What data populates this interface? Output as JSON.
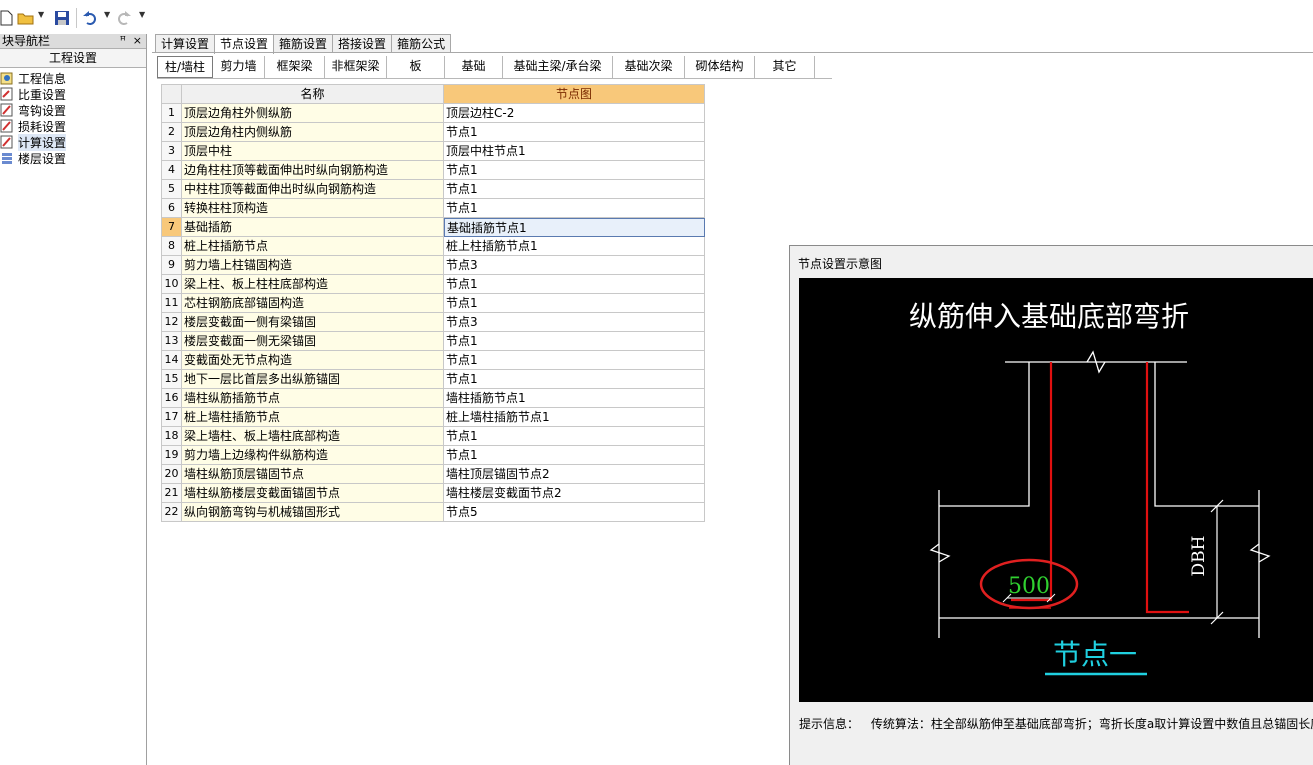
{
  "toolbar": {
    "icons": [
      "new-file-icon",
      "open-folder-icon",
      "save-icon",
      "undo-icon",
      "redo-icon"
    ]
  },
  "nav": {
    "title": "块导航栏",
    "pin": "ₕ",
    "close": "×",
    "section": "工程设置",
    "items": [
      {
        "label": "工程信息"
      },
      {
        "label": "比重设置"
      },
      {
        "label": "弯钩设置"
      },
      {
        "label": "损耗设置"
      },
      {
        "label": "计算设置"
      },
      {
        "label": "楼层设置"
      }
    ]
  },
  "tabs": [
    "计算设置",
    "节点设置",
    "箍筋设置",
    "搭接设置",
    "箍筋公式"
  ],
  "subtabs": [
    "柱/墙柱",
    "剪力墙",
    "框架梁",
    "非框架梁",
    "板",
    "基础",
    "基础主梁/承台梁",
    "基础次梁",
    "砌体结构",
    "其它"
  ],
  "table": {
    "header_name": "名称",
    "header_node": "节点图",
    "rows": [
      {
        "num": "1",
        "name": "顶层边角柱外侧纵筋",
        "node": "顶层边柱C-2"
      },
      {
        "num": "2",
        "name": "顶层边角柱内侧纵筋",
        "node": "节点1"
      },
      {
        "num": "3",
        "name": "顶层中柱",
        "node": "顶层中柱节点1"
      },
      {
        "num": "4",
        "name": "边角柱柱顶等截面伸出时纵向钢筋构造",
        "node": "节点1"
      },
      {
        "num": "5",
        "name": "中柱柱顶等截面伸出时纵向钢筋构造",
        "node": "节点1"
      },
      {
        "num": "6",
        "name": "转换柱柱顶构造",
        "node": "节点1"
      },
      {
        "num": "7",
        "name": "基础插筋",
        "node": "基础插筋节点1"
      },
      {
        "num": "8",
        "name": "桩上柱插筋节点",
        "node": "桩上柱插筋节点1"
      },
      {
        "num": "9",
        "name": "剪力墙上柱锚固构造",
        "node": "节点3"
      },
      {
        "num": "10",
        "name": "梁上柱、板上柱柱底部构造",
        "node": "节点1"
      },
      {
        "num": "11",
        "name": "芯柱钢筋底部锚固构造",
        "node": "节点1"
      },
      {
        "num": "12",
        "name": "楼层变截面一侧有梁锚固",
        "node": "节点3"
      },
      {
        "num": "13",
        "name": "楼层变截面一侧无梁锚固",
        "node": "节点1"
      },
      {
        "num": "14",
        "name": "变截面处无节点构造",
        "node": "节点1"
      },
      {
        "num": "15",
        "name": "地下一层比首层多出纵筋锚固",
        "node": "节点1"
      },
      {
        "num": "16",
        "name": "墙柱纵筋插筋节点",
        "node": "墙柱插筋节点1"
      },
      {
        "num": "17",
        "name": "桩上墙柱插筋节点",
        "node": "桩上墙柱插筋节点1"
      },
      {
        "num": "18",
        "name": "梁上墙柱、板上墙柱底部构造",
        "node": "节点1"
      },
      {
        "num": "19",
        "name": "剪力墙上边缘构件纵筋构造",
        "node": "节点1"
      },
      {
        "num": "20",
        "name": "墙柱纵筋顶层锚固节点",
        "node": "墙柱顶层锚固节点2"
      },
      {
        "num": "21",
        "name": "墙柱纵筋楼层变截面锚固节点",
        "node": "墙柱楼层变截面节点2"
      },
      {
        "num": "22",
        "name": "纵向钢筋弯钩与机械锚固形式",
        "node": "节点5"
      }
    ],
    "selected_row": 7
  },
  "preview": {
    "title": "节点设置示意图",
    "diagram_title": "纵筋伸入基础底部弯折",
    "dim_label": "DBH",
    "bend_value": "500",
    "node_label": "节点一",
    "hint_label": "提示信息：",
    "hint_text": "传统算法：柱全部纵筋伸至基础底部弯折；弯折长度a取计算设置中数值且总锚固长度"
  },
  "colors": {
    "header_orange": "#f8c87a",
    "name_col_bg": "#fffde6",
    "rebar_red": "#e01010",
    "dim_green": "#30d030",
    "node_cyan": "#20d0e0"
  }
}
